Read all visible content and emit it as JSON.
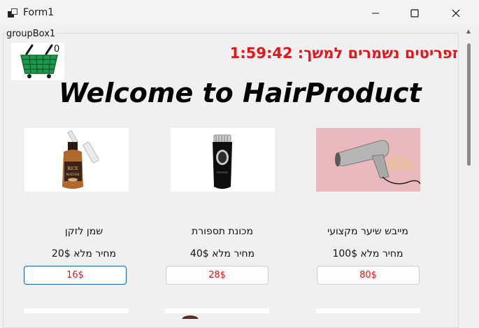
{
  "window": {
    "title": "Form1"
  },
  "groupbox": {
    "label": "groupBox1"
  },
  "cart": {
    "count": "0"
  },
  "timer": {
    "text": "זפריטים נשמרים למשך: 1:59:42"
  },
  "welcome": {
    "text": "Welcome to HairProduct"
  },
  "products": [
    {
      "name": "שמן לזקן",
      "price": "מחיר מלא 20$",
      "sale": "16$"
    },
    {
      "name": "מכונת תספורת",
      "price": "מחיר מלא 40$",
      "sale": "28$"
    },
    {
      "name": "מייבש שיער מקצועי",
      "price": "מחיר מלא 100$",
      "sale": "80$"
    }
  ],
  "colors": {
    "accent_red": "#e8141c",
    "focus_blue": "#1565c0"
  },
  "icons": [
    "app-icon",
    "minimize-icon",
    "maximize-icon",
    "close-icon",
    "shopping-basket-icon"
  ]
}
